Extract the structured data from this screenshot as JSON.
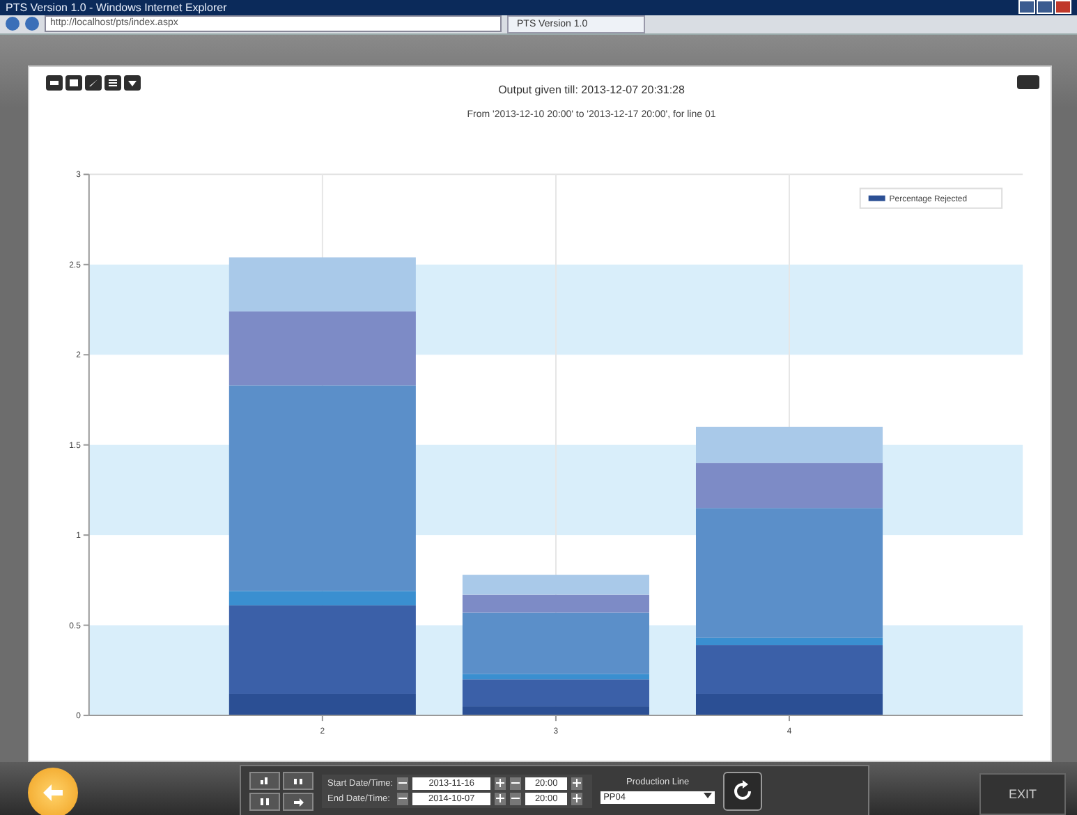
{
  "window": {
    "title": "PTS Version 1.0 - Windows Internet Explorer"
  },
  "browser": {
    "address": "http://localhost/pts/index.aspx",
    "tab": "PTS Version 1.0"
  },
  "report": {
    "title": "Output given till: 2013-12-07 20:31:28",
    "subtitle": "From '2013-12-10 20:00' to '2013-12-17 20:00', for line 01",
    "chart_data": {
      "type": "bar",
      "stacked": true,
      "categories": [
        "2",
        "3",
        "4"
      ],
      "grid": true,
      "ylim": [
        0,
        3
      ],
      "yticks": [
        0,
        0.5,
        1,
        1.5,
        2,
        2.5,
        3
      ],
      "series": [
        {
          "name": "Percentage Rejected",
          "color": "#2b4f94",
          "values": [
            0.12,
            0.05,
            0.12
          ]
        },
        {
          "color": "#3b60a8",
          "values": [
            0.49,
            0.15,
            0.27
          ]
        },
        {
          "color": "#3a8fd0",
          "values": [
            0.08,
            0.03,
            0.04
          ]
        },
        {
          "color": "#5b8fc9",
          "values": [
            1.14,
            0.34,
            0.72
          ]
        },
        {
          "color": "#7d8bc6",
          "values": [
            0.41,
            0.1,
            0.25
          ]
        },
        {
          "color": "#a9c9e9",
          "values": [
            0.3,
            0.11,
            0.2
          ]
        }
      ]
    }
  },
  "controls": {
    "start_label": "Start Date/Time:",
    "start_date": "2013-11-16",
    "start_time": "20:00",
    "end_label": "End Date/Time:",
    "end_date": "2014-10-07",
    "end_time": "20:00",
    "line_label": "Production Line",
    "line_value": "PP04",
    "exit": "EXIT"
  }
}
